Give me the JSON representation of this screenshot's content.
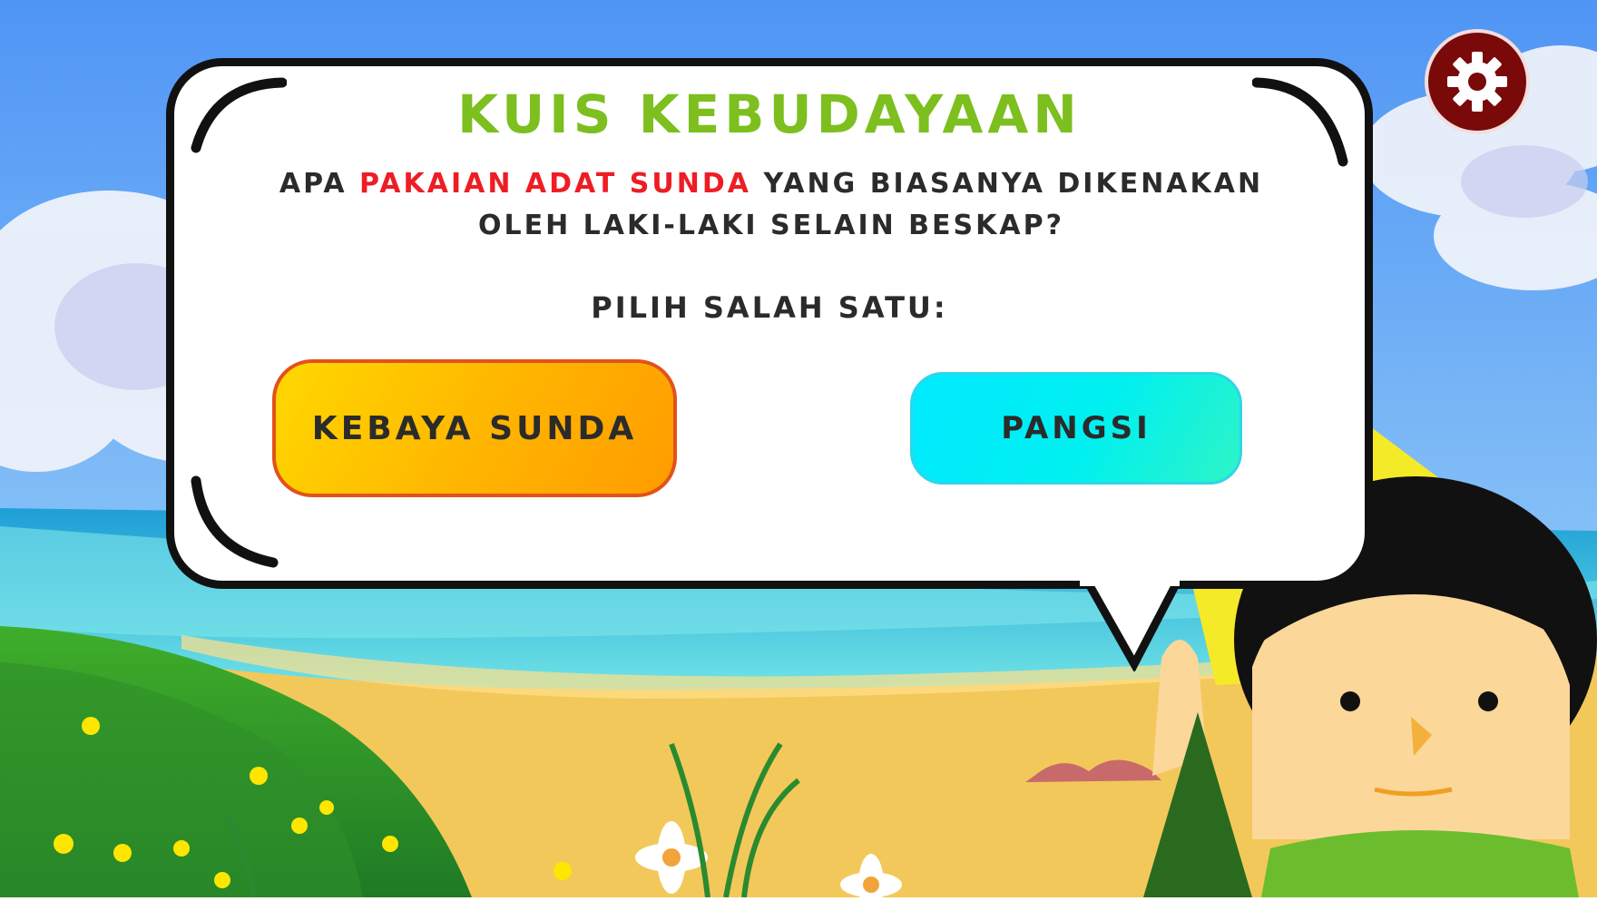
{
  "quiz": {
    "title": "KUIS KEBUDAYAAN",
    "question_part1": "APA ",
    "question_highlight": "PAKAIAN ADAT SUNDA",
    "question_part2": " YANG BIASANYA DIKENAKAN OLEH LAKI-LAKI SELAIN BESKAP?",
    "prompt": "PILIH SALAH SATU:"
  },
  "answers": [
    {
      "label": "KEBAYA SUNDA"
    },
    {
      "label": "PANGSI"
    }
  ],
  "icons": {
    "settings": "gear-icon",
    "character": "mascot-girl"
  },
  "colors": {
    "title": "#7cbf1e",
    "highlight": "#ee1d24",
    "answer_a": "#ffb400",
    "answer_b": "#00e9ff",
    "settings_bg": "#7a0a0a"
  }
}
